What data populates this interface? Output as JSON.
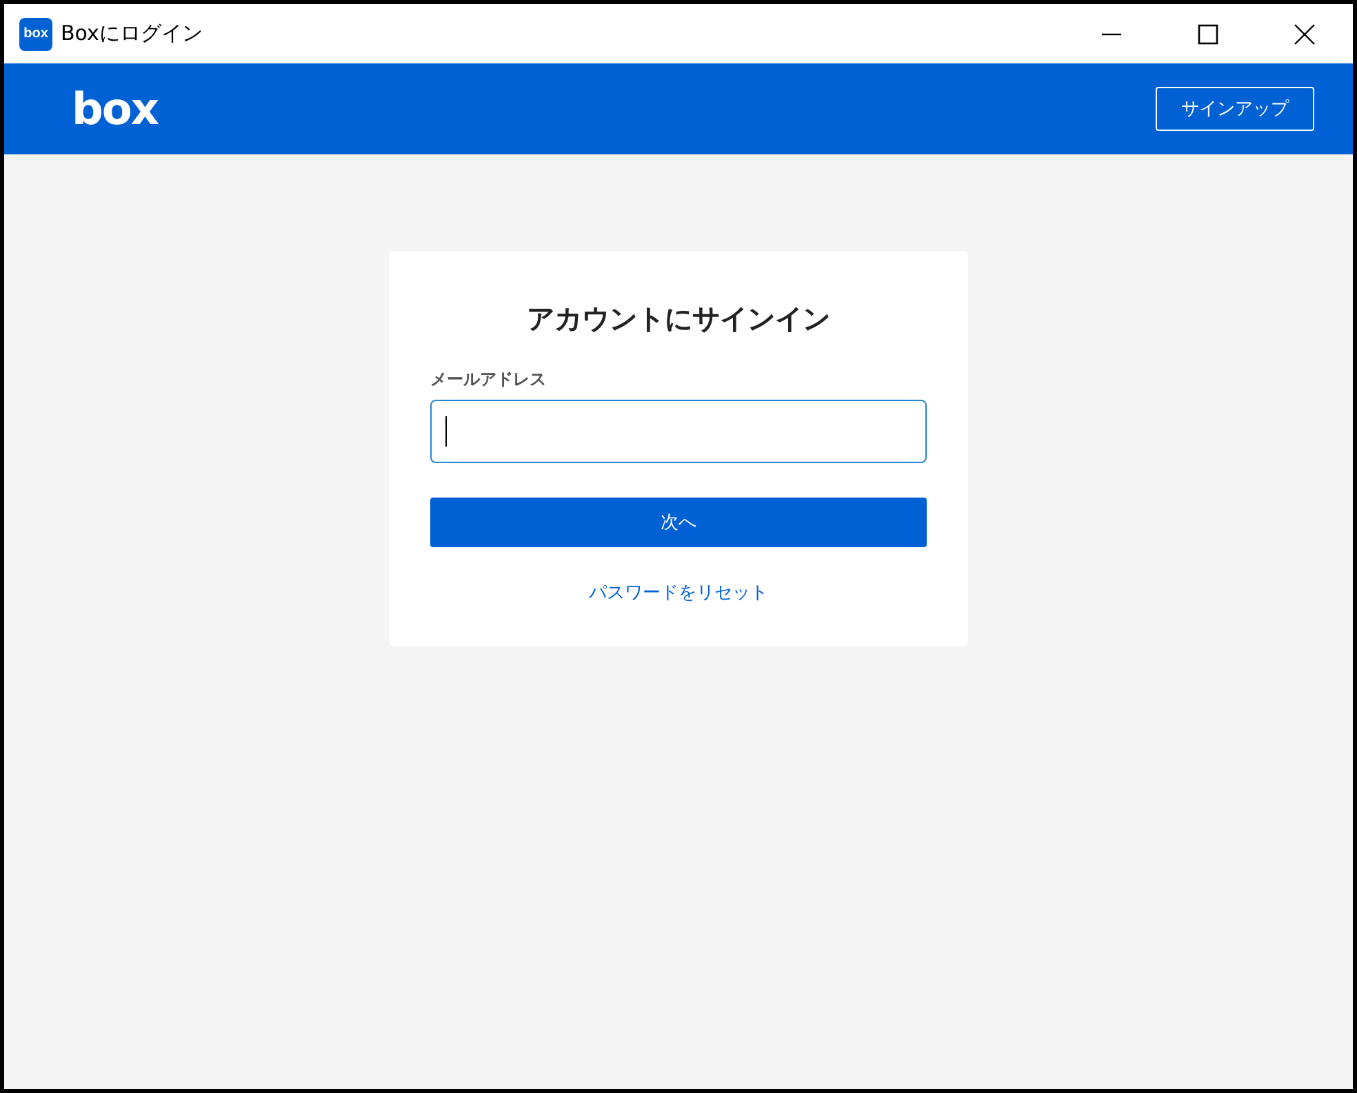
{
  "window": {
    "title": "Boxにログイン",
    "app_icon_text": "box"
  },
  "header": {
    "logo": "box",
    "signup_button": "サインアップ"
  },
  "card": {
    "title": "アカウントにサインイン",
    "email": {
      "label": "メールアドレス",
      "focused": true
    },
    "next_button": "次へ",
    "reset_link": "パスワードをリセット"
  }
}
